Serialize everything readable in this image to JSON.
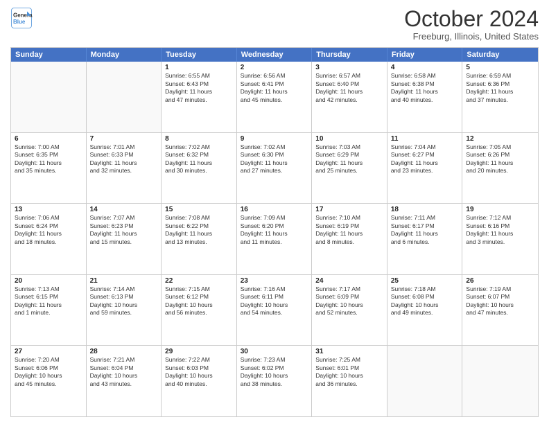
{
  "header": {
    "logo_line1": "General",
    "logo_line2": "Blue",
    "main_title": "October 2024",
    "subtitle": "Freeburg, Illinois, United States"
  },
  "days": [
    "Sunday",
    "Monday",
    "Tuesday",
    "Wednesday",
    "Thursday",
    "Friday",
    "Saturday"
  ],
  "rows": [
    [
      {
        "day": "",
        "lines": []
      },
      {
        "day": "",
        "lines": []
      },
      {
        "day": "1",
        "lines": [
          "Sunrise: 6:55 AM",
          "Sunset: 6:43 PM",
          "Daylight: 11 hours",
          "and 47 minutes."
        ]
      },
      {
        "day": "2",
        "lines": [
          "Sunrise: 6:56 AM",
          "Sunset: 6:41 PM",
          "Daylight: 11 hours",
          "and 45 minutes."
        ]
      },
      {
        "day": "3",
        "lines": [
          "Sunrise: 6:57 AM",
          "Sunset: 6:40 PM",
          "Daylight: 11 hours",
          "and 42 minutes."
        ]
      },
      {
        "day": "4",
        "lines": [
          "Sunrise: 6:58 AM",
          "Sunset: 6:38 PM",
          "Daylight: 11 hours",
          "and 40 minutes."
        ]
      },
      {
        "day": "5",
        "lines": [
          "Sunrise: 6:59 AM",
          "Sunset: 6:36 PM",
          "Daylight: 11 hours",
          "and 37 minutes."
        ]
      }
    ],
    [
      {
        "day": "6",
        "lines": [
          "Sunrise: 7:00 AM",
          "Sunset: 6:35 PM",
          "Daylight: 11 hours",
          "and 35 minutes."
        ]
      },
      {
        "day": "7",
        "lines": [
          "Sunrise: 7:01 AM",
          "Sunset: 6:33 PM",
          "Daylight: 11 hours",
          "and 32 minutes."
        ]
      },
      {
        "day": "8",
        "lines": [
          "Sunrise: 7:02 AM",
          "Sunset: 6:32 PM",
          "Daylight: 11 hours",
          "and 30 minutes."
        ]
      },
      {
        "day": "9",
        "lines": [
          "Sunrise: 7:02 AM",
          "Sunset: 6:30 PM",
          "Daylight: 11 hours",
          "and 27 minutes."
        ]
      },
      {
        "day": "10",
        "lines": [
          "Sunrise: 7:03 AM",
          "Sunset: 6:29 PM",
          "Daylight: 11 hours",
          "and 25 minutes."
        ]
      },
      {
        "day": "11",
        "lines": [
          "Sunrise: 7:04 AM",
          "Sunset: 6:27 PM",
          "Daylight: 11 hours",
          "and 23 minutes."
        ]
      },
      {
        "day": "12",
        "lines": [
          "Sunrise: 7:05 AM",
          "Sunset: 6:26 PM",
          "Daylight: 11 hours",
          "and 20 minutes."
        ]
      }
    ],
    [
      {
        "day": "13",
        "lines": [
          "Sunrise: 7:06 AM",
          "Sunset: 6:24 PM",
          "Daylight: 11 hours",
          "and 18 minutes."
        ]
      },
      {
        "day": "14",
        "lines": [
          "Sunrise: 7:07 AM",
          "Sunset: 6:23 PM",
          "Daylight: 11 hours",
          "and 15 minutes."
        ]
      },
      {
        "day": "15",
        "lines": [
          "Sunrise: 7:08 AM",
          "Sunset: 6:22 PM",
          "Daylight: 11 hours",
          "and 13 minutes."
        ]
      },
      {
        "day": "16",
        "lines": [
          "Sunrise: 7:09 AM",
          "Sunset: 6:20 PM",
          "Daylight: 11 hours",
          "and 11 minutes."
        ]
      },
      {
        "day": "17",
        "lines": [
          "Sunrise: 7:10 AM",
          "Sunset: 6:19 PM",
          "Daylight: 11 hours",
          "and 8 minutes."
        ]
      },
      {
        "day": "18",
        "lines": [
          "Sunrise: 7:11 AM",
          "Sunset: 6:17 PM",
          "Daylight: 11 hours",
          "and 6 minutes."
        ]
      },
      {
        "day": "19",
        "lines": [
          "Sunrise: 7:12 AM",
          "Sunset: 6:16 PM",
          "Daylight: 11 hours",
          "and 3 minutes."
        ]
      }
    ],
    [
      {
        "day": "20",
        "lines": [
          "Sunrise: 7:13 AM",
          "Sunset: 6:15 PM",
          "Daylight: 11 hours",
          "and 1 minute."
        ]
      },
      {
        "day": "21",
        "lines": [
          "Sunrise: 7:14 AM",
          "Sunset: 6:13 PM",
          "Daylight: 10 hours",
          "and 59 minutes."
        ]
      },
      {
        "day": "22",
        "lines": [
          "Sunrise: 7:15 AM",
          "Sunset: 6:12 PM",
          "Daylight: 10 hours",
          "and 56 minutes."
        ]
      },
      {
        "day": "23",
        "lines": [
          "Sunrise: 7:16 AM",
          "Sunset: 6:11 PM",
          "Daylight: 10 hours",
          "and 54 minutes."
        ]
      },
      {
        "day": "24",
        "lines": [
          "Sunrise: 7:17 AM",
          "Sunset: 6:09 PM",
          "Daylight: 10 hours",
          "and 52 minutes."
        ]
      },
      {
        "day": "25",
        "lines": [
          "Sunrise: 7:18 AM",
          "Sunset: 6:08 PM",
          "Daylight: 10 hours",
          "and 49 minutes."
        ]
      },
      {
        "day": "26",
        "lines": [
          "Sunrise: 7:19 AM",
          "Sunset: 6:07 PM",
          "Daylight: 10 hours",
          "and 47 minutes."
        ]
      }
    ],
    [
      {
        "day": "27",
        "lines": [
          "Sunrise: 7:20 AM",
          "Sunset: 6:06 PM",
          "Daylight: 10 hours",
          "and 45 minutes."
        ]
      },
      {
        "day": "28",
        "lines": [
          "Sunrise: 7:21 AM",
          "Sunset: 6:04 PM",
          "Daylight: 10 hours",
          "and 43 minutes."
        ]
      },
      {
        "day": "29",
        "lines": [
          "Sunrise: 7:22 AM",
          "Sunset: 6:03 PM",
          "Daylight: 10 hours",
          "and 40 minutes."
        ]
      },
      {
        "day": "30",
        "lines": [
          "Sunrise: 7:23 AM",
          "Sunset: 6:02 PM",
          "Daylight: 10 hours",
          "and 38 minutes."
        ]
      },
      {
        "day": "31",
        "lines": [
          "Sunrise: 7:25 AM",
          "Sunset: 6:01 PM",
          "Daylight: 10 hours",
          "and 36 minutes."
        ]
      },
      {
        "day": "",
        "lines": []
      },
      {
        "day": "",
        "lines": []
      }
    ]
  ]
}
